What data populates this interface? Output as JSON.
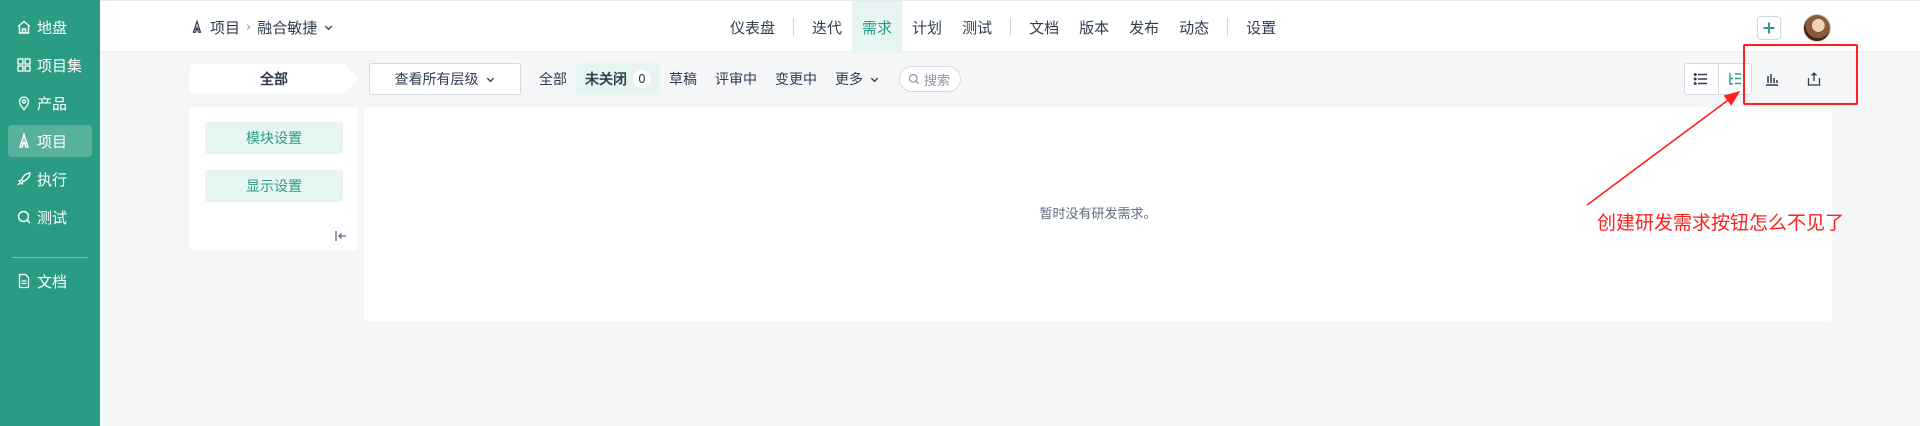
{
  "sidebar": {
    "items": [
      {
        "label": "地盘",
        "icon": "home-icon"
      },
      {
        "label": "项目集",
        "icon": "grid-icon"
      },
      {
        "label": "产品",
        "icon": "location-pin-icon"
      },
      {
        "label": "项目",
        "icon": "rocket-icon"
      },
      {
        "label": "执行",
        "icon": "rocket-launch-icon"
      },
      {
        "label": "测试",
        "icon": "search-icon"
      },
      {
        "label": "文档",
        "icon": "document-icon"
      }
    ],
    "active": "项目"
  },
  "header": {
    "breadcrumb": {
      "root": "项目",
      "current": "融合敏捷"
    },
    "nav": [
      {
        "label": "仪表盘"
      },
      {
        "label": "迭代"
      },
      {
        "label": "需求"
      },
      {
        "label": "计划"
      },
      {
        "label": "测试"
      },
      {
        "label": "文档"
      },
      {
        "label": "版本"
      },
      {
        "label": "发布"
      },
      {
        "label": "动态"
      },
      {
        "label": "设置"
      }
    ],
    "active_nav": "需求"
  },
  "toolbar": {
    "all_tab": "全部",
    "level_select": "查看所有层级",
    "filters": [
      {
        "label": "全部"
      },
      {
        "label": "未关闭",
        "count": "0"
      },
      {
        "label": "草稿"
      },
      {
        "label": "评审中"
      },
      {
        "label": "变更中"
      },
      {
        "label": "更多"
      }
    ],
    "search_placeholder": "搜索"
  },
  "left_panel": {
    "module_settings": "模块设置",
    "display_settings": "显示设置"
  },
  "content": {
    "empty_text": "暂时没有研发需求。"
  },
  "annotation": {
    "text": "创建研发需求按钮怎么不见了",
    "color": "#ff2020"
  },
  "colors": {
    "sidebar": "#2a9c84",
    "accent": "#2a9c84",
    "accent_light": "#e6f5f1"
  }
}
